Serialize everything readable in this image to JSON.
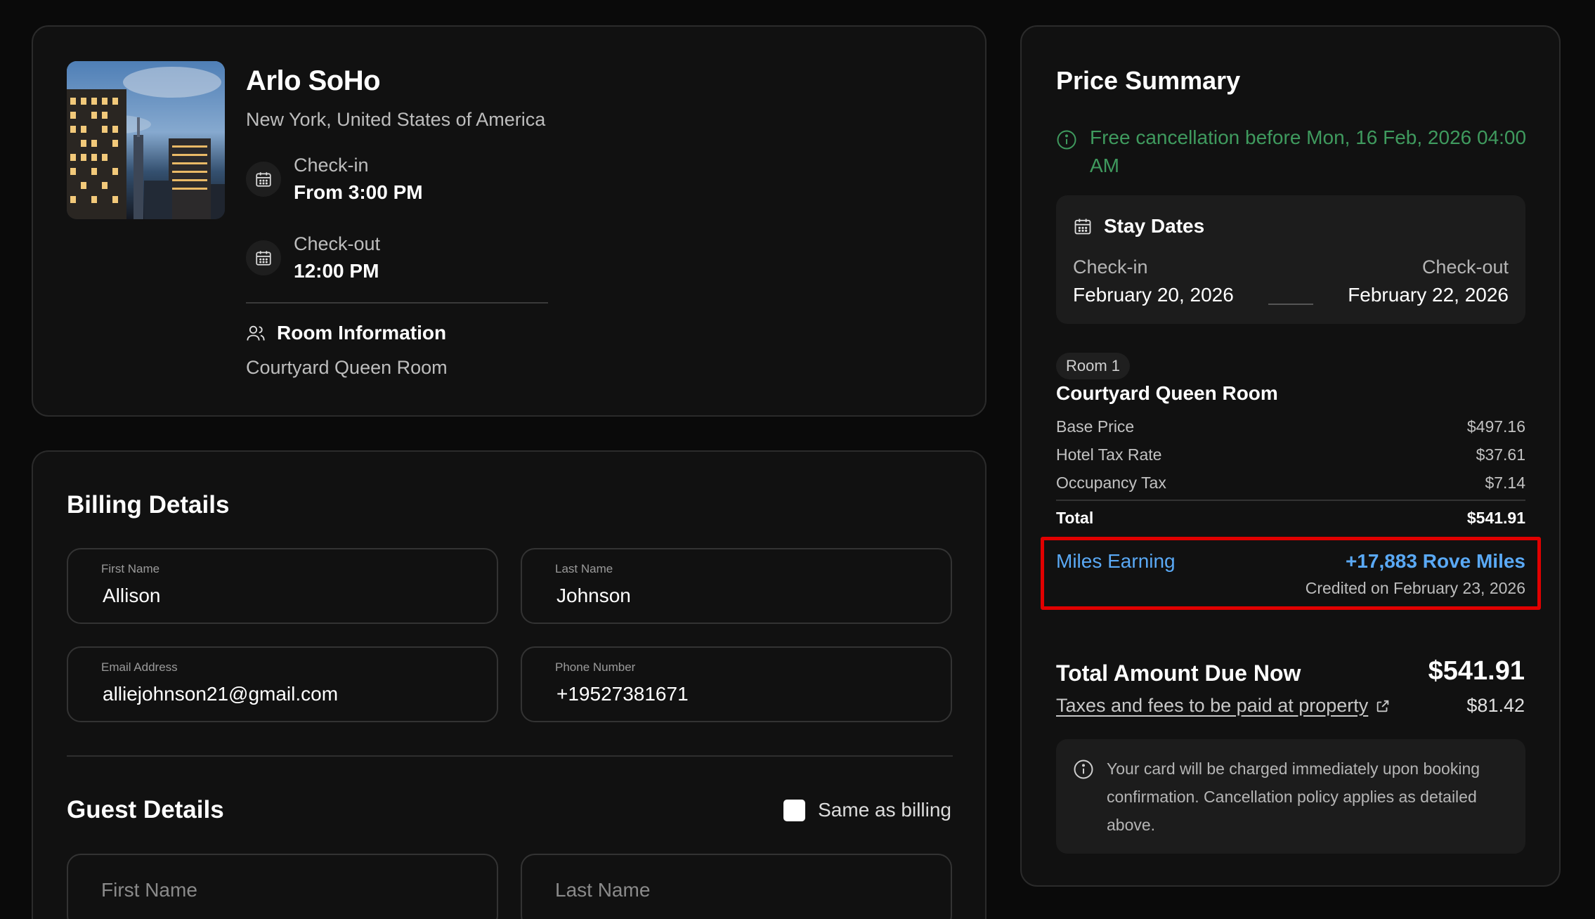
{
  "hotel": {
    "name": "Arlo SoHo",
    "location": "New York, United States of America",
    "checkin_label": "Check-in",
    "checkin_time": "From 3:00 PM",
    "checkout_label": "Check-out",
    "checkout_time": "12:00 PM",
    "room_info_label": "Room Information",
    "room_type": "Courtyard Queen Room"
  },
  "billing": {
    "title": "Billing Details",
    "first_name": {
      "label": "First Name",
      "value": "Allison"
    },
    "last_name": {
      "label": "Last Name",
      "value": "Johnson"
    },
    "email": {
      "label": "Email Address",
      "value": "alliejohnson21@gmail.com"
    },
    "phone": {
      "label": "Phone Number",
      "value": "+19527381671"
    }
  },
  "guest": {
    "title": "Guest Details",
    "same_as_billing_label": "Same as billing",
    "same_as_billing_checked": false,
    "first_name_placeholder": "First Name",
    "last_name_placeholder": "Last Name"
  },
  "price_summary": {
    "title": "Price Summary",
    "free_cancellation": "Free cancellation before Mon, 16 Feb, 2026 04:00 AM",
    "stay_dates": {
      "title": "Stay Dates",
      "checkin_label": "Check-in",
      "checkin_date": "February 20, 2026",
      "checkout_label": "Check-out",
      "checkout_date": "February 22, 2026"
    },
    "room_badge": "Room 1",
    "room_name": "Courtyard Queen Room",
    "lines": [
      {
        "label": "Base Price",
        "amount": "$497.16"
      },
      {
        "label": "Hotel Tax Rate",
        "amount": "$37.61"
      },
      {
        "label": "Occupancy Tax",
        "amount": "$7.14"
      }
    ],
    "total_label": "Total",
    "total_amount": "$541.91",
    "miles": {
      "label": "Miles Earning",
      "value": "+17,883 Rove Miles",
      "credit_note": "Credited on February 23, 2026"
    },
    "due_label": "Total Amount Due Now",
    "due_amount": "$541.91",
    "taxes_link": "Taxes and fees to be paid at property",
    "taxes_amount": "$81.42",
    "note": "Your card will be charged immediately upon booking confirmation. Cancellation policy applies as detailed above."
  },
  "colors": {
    "background": "#0a0a0a",
    "card": "#111111",
    "success_green": "#3f9a5e",
    "miles_blue": "#5aa9f5",
    "highlight_red": "#e10000"
  }
}
